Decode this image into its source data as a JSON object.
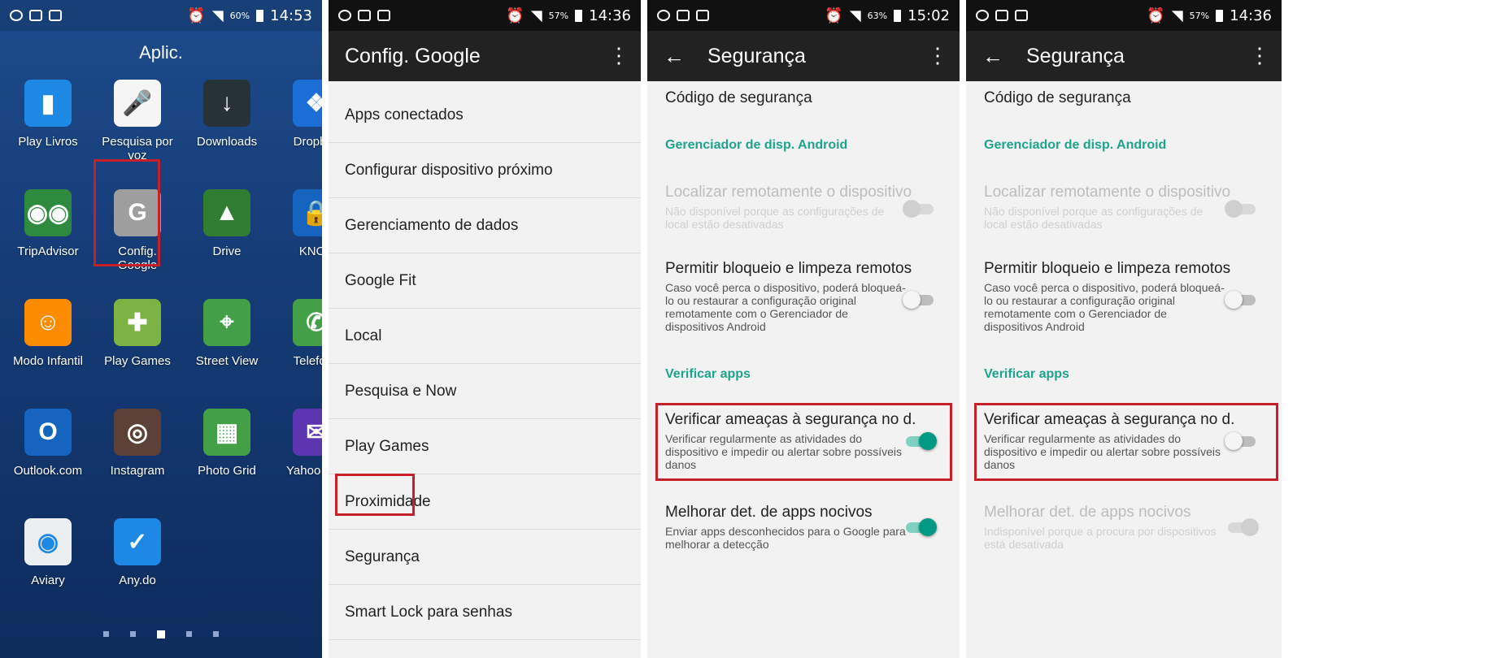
{
  "status_bars": [
    {
      "time": "14:53",
      "battery": "60%"
    },
    {
      "time": "14:36",
      "battery": "57%"
    },
    {
      "time": "15:02",
      "battery": "63%"
    },
    {
      "time": "14:36",
      "battery": "57%"
    }
  ],
  "home": {
    "title": "Aplic.",
    "apps": [
      {
        "label": "Play Livros",
        "color": "#1e88e5",
        "glyph": "▮"
      },
      {
        "label": "Pesquisa por voz",
        "color": "#f5f5f5",
        "glyph": "🎤"
      },
      {
        "label": "Downloads",
        "color": "#263238",
        "glyph": "↓"
      },
      {
        "label": "Dropbox",
        "color": "#1c6fd6",
        "glyph": "❖"
      },
      {
        "label": "TripAdvisor",
        "color": "#2d8a3e",
        "glyph": "◉◉"
      },
      {
        "label": "Config. Google",
        "color": "#9e9e9e",
        "glyph": "G"
      },
      {
        "label": "Drive",
        "color": "#2e7d32",
        "glyph": "▲"
      },
      {
        "label": "KNOX",
        "color": "#1565c0",
        "glyph": "🔒"
      },
      {
        "label": "Modo Infantil",
        "color": "#fb8c00",
        "glyph": "☺"
      },
      {
        "label": "Play Games",
        "color": "#7cb342",
        "glyph": "✚"
      },
      {
        "label": "Street View",
        "color": "#43a047",
        "glyph": "⌖"
      },
      {
        "label": "Telefone",
        "color": "#43a047",
        "glyph": "✆"
      },
      {
        "label": "Outlook.com",
        "color": "#1565c0",
        "glyph": "O"
      },
      {
        "label": "Instagram",
        "color": "#5d4037",
        "glyph": "◎"
      },
      {
        "label": "Photo Grid",
        "color": "#43a047",
        "glyph": "▦"
      },
      {
        "label": "Yahoo Mail",
        "color": "#5e35b1",
        "glyph": "✉"
      },
      {
        "label": "Aviary",
        "color": "#eceff1",
        "glyph": "◉"
      },
      {
        "label": "Any.do",
        "color": "#1e88e5",
        "glyph": "✓"
      }
    ]
  },
  "google_settings": {
    "title": "Config. Google",
    "items": [
      "Apps conectados",
      "Configurar dispositivo próximo",
      "Gerenciamento de dados",
      "Google Fit",
      "Local",
      "Pesquisa e Now",
      "Play Games",
      "Proximidade",
      "Segurança",
      "Smart Lock para senhas"
    ]
  },
  "security_a": {
    "title": "Segurança",
    "code_label": "Código de segurança",
    "header_device": "Gerenciador de disp. Android",
    "locate_title": "Localizar remotamente o dispositivo",
    "locate_sub": "Não disponível porque as configurações de local estão desativadas",
    "lock_title": "Permitir bloqueio e limpeza remotos",
    "lock_sub": "Caso você perca o dispositivo, poderá bloqueá-lo ou restaurar a configuração original remotamente com o Gerenciador de dispositivos Android",
    "header_verify": "Verificar apps",
    "scan_title": "Verificar ameaças à segurança no d.",
    "scan_sub": "Verificar regularmente as atividades do dispositivo e impedir ou alertar sobre possíveis danos",
    "improve_title": "Melhorar det. de apps nocivos",
    "improve_sub": "Enviar apps desconhecidos para o Google para melhorar a detecção"
  },
  "security_b": {
    "title": "Segurança",
    "code_label": "Código de segurança",
    "header_device": "Gerenciador de disp. Android",
    "locate_title": "Localizar remotamente o dispositivo",
    "locate_sub": "Não disponível porque as configurações de local estão desativadas",
    "lock_title": "Permitir bloqueio e limpeza remotos",
    "lock_sub": "Caso você perca o dispositivo, poderá bloqueá-lo ou restaurar a configuração original remotamente com o Gerenciador de dispositivos Android",
    "header_verify": "Verificar apps",
    "scan_title": "Verificar ameaças à segurança no d.",
    "scan_sub": "Verificar regularmente as atividades do dispositivo e impedir ou alertar sobre possíveis danos",
    "improve_title": "Melhorar det. de apps nocivos",
    "improve_sub": "Indisponível porque a procura por dispositivos está desativada"
  },
  "colors": {
    "accent": "#1ea38d",
    "highlight": "#c8202b",
    "toggle_on": "#009a84"
  }
}
